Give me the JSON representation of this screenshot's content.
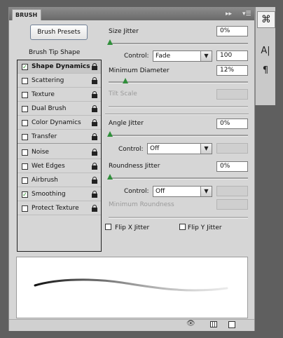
{
  "panel": {
    "tab_title": "BRUSH",
    "expand_icon": "double-arrow-right-icon",
    "menu_icon": "panel-menu-icon"
  },
  "brush_presets_button": "Brush Presets",
  "left_list": {
    "header": "Brush Tip Shape",
    "items": [
      {
        "label": "Shape Dynamics",
        "checked": true,
        "selected": true
      },
      {
        "label": "Scattering",
        "checked": false
      },
      {
        "label": "Texture",
        "checked": false
      },
      {
        "label": "Dual Brush",
        "checked": false
      },
      {
        "label": "Color Dynamics",
        "checked": false
      },
      {
        "label": "Transfer",
        "checked": false
      },
      {
        "label": "Noise",
        "checked": false
      },
      {
        "label": "Wet Edges",
        "checked": false
      },
      {
        "label": "Airbrush",
        "checked": false
      },
      {
        "label": "Smoothing",
        "checked": true
      },
      {
        "label": "Protect Texture",
        "checked": false
      }
    ],
    "check_mark": "✓"
  },
  "settings": {
    "size_jitter": {
      "label": "Size Jitter",
      "value": "0%",
      "slider": 0.0
    },
    "size_control": {
      "label": "Control:",
      "value": "Fade",
      "number": "100"
    },
    "min_diameter": {
      "label": "Minimum Diameter",
      "value": "12%",
      "slider": 0.12
    },
    "tilt_scale": {
      "label": "Tilt Scale",
      "value": ""
    },
    "angle_jitter": {
      "label": "Angle Jitter",
      "value": "0%",
      "slider": 0.0
    },
    "angle_control": {
      "label": "Control:",
      "value": "Off"
    },
    "roundness_jitter": {
      "label": "Roundness Jitter",
      "value": "0%",
      "slider": 0.0
    },
    "roundness_control": {
      "label": "Control:",
      "value": "Off"
    },
    "min_roundness": {
      "label": "Minimum Roundness",
      "value": ""
    },
    "flip_x": {
      "label": "Flip X Jitter",
      "checked": false
    },
    "flip_y": {
      "label": "Flip Y Jitter",
      "checked": false
    }
  },
  "bottom_icons": [
    "eye-brush-icon",
    "grid-icon",
    "new-preset-icon"
  ],
  "side_icons": [
    "brush-panel-icon",
    "character-icon",
    "paragraph-icon"
  ],
  "side_glyphs": {
    "character": "A|",
    "paragraph": "¶"
  },
  "colors": {
    "accent_green": "#2f8f3a",
    "check_green": "#1a8a1a"
  }
}
